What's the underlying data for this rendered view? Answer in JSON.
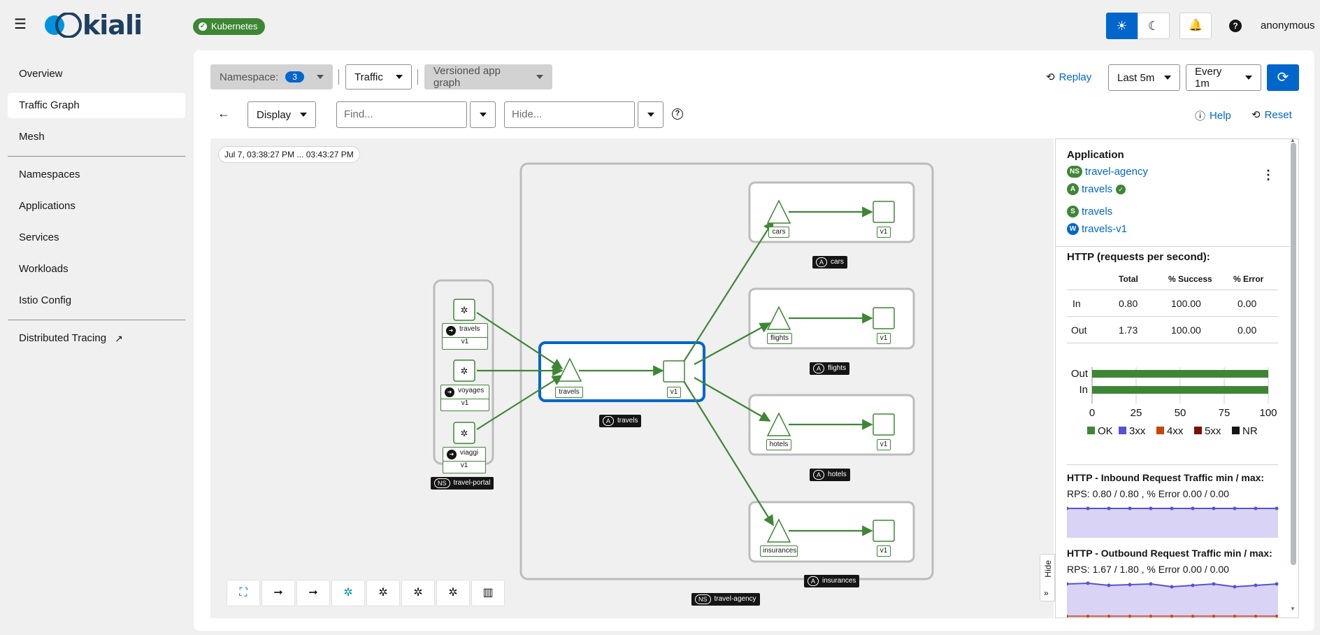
{
  "header": {
    "brand": "kiali",
    "cluster_badge": "Kubernetes",
    "user": "anonymous"
  },
  "sidebar": {
    "items": [
      {
        "label": "Overview"
      },
      {
        "label": "Traffic Graph",
        "active": true
      },
      {
        "label": "Mesh"
      },
      {
        "label": "Namespaces"
      },
      {
        "label": "Applications"
      },
      {
        "label": "Services"
      },
      {
        "label": "Workloads"
      },
      {
        "label": "Istio Config"
      },
      {
        "label": "Distributed Tracing"
      }
    ]
  },
  "toolbar": {
    "namespace_label": "Namespace:",
    "namespace_count": "3",
    "traffic_label": "Traffic",
    "graph_type": "Versioned app graph",
    "replay_label": "Replay",
    "duration": "Last 5m",
    "refresh_interval": "Every 1m",
    "display_label": "Display",
    "find_placeholder": "Find...",
    "hide_placeholder": "Hide...",
    "help_label": "Help",
    "reset_label": "Reset"
  },
  "graph": {
    "time_range": "Jul 7, 03:38:27 PM ... 03:43:27 PM",
    "namespaces": {
      "travel_portal": "travel-portal",
      "travel_agency": "travel-agency"
    },
    "portal_nodes": [
      {
        "app": "travels",
        "version": "v1"
      },
      {
        "app": "voyages",
        "version": "v1"
      },
      {
        "app": "viaggi",
        "version": "v1"
      }
    ],
    "agency_apps": [
      {
        "name": "travels",
        "service": "travels",
        "version": "v1"
      },
      {
        "name": "cars",
        "service": "cars",
        "version": "v1"
      },
      {
        "name": "flights",
        "service": "flights",
        "version": "v1"
      },
      {
        "name": "hotels",
        "service": "hotels",
        "version": "v1"
      },
      {
        "name": "insurances",
        "service": "insurances",
        "version": "v1"
      }
    ],
    "app_badge": "A",
    "ns_badge": "NS"
  },
  "panel": {
    "title": "Application",
    "ns_badge": "NS",
    "namespace": "travel-agency",
    "app_badge": "A",
    "app": "travels",
    "service_badge": "S",
    "service": "travels",
    "workload_badge": "W",
    "workload": "travels-v1",
    "http_title": "HTTP (requests per second):",
    "table": {
      "headers": [
        "Total",
        "% Success",
        "% Error"
      ],
      "rows": [
        {
          "dir": "In",
          "total": "0.80",
          "success": "100.00",
          "error": "0.00"
        },
        {
          "dir": "Out",
          "total": "1.73",
          "success": "100.00",
          "error": "0.00"
        }
      ]
    },
    "bar_chart": {
      "categories": [
        "Out",
        "In"
      ],
      "ok_values": [
        100,
        100
      ],
      "ticks": [
        "0",
        "25",
        "50",
        "75",
        "100"
      ],
      "legend": [
        {
          "label": "OK",
          "color": "#3e8635"
        },
        {
          "label": "3xx",
          "color": "#5752d1"
        },
        {
          "label": "4xx",
          "color": "#c9450c"
        },
        {
          "label": "5xx",
          "color": "#7d1007"
        },
        {
          "label": "NR",
          "color": "#151515"
        }
      ]
    },
    "inbound_title": "HTTP - Inbound Request Traffic min / max:",
    "inbound_stats": "RPS: 0.80 / 0.80 , % Error 0.00 / 0.00",
    "outbound_title": "HTTP - Outbound Request Traffic min / max:",
    "outbound_stats": "RPS: 1.67 / 1.80 , % Error 0.00 / 0.00",
    "hide_label": "Hide"
  },
  "colors": {
    "accent": "#0066cc",
    "edge": "#3e8635",
    "selected": "#0066cc"
  }
}
